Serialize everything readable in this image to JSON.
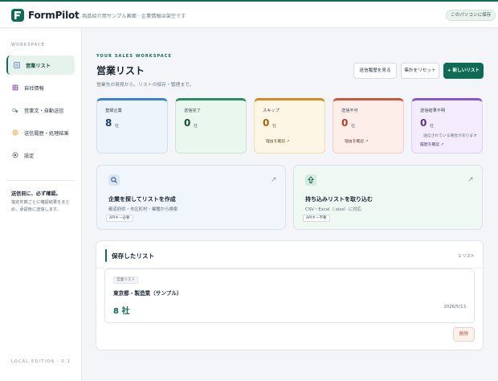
{
  "header": {
    "app_name": "FormPilot",
    "description": "商品紹介用サンプル画面 · 企業情報は架空です",
    "save_local_label": "このパソコンに保存"
  },
  "sidebar": {
    "workspace_label": "WORKSPACE",
    "items": [
      {
        "label": "営業リスト",
        "icon": "list-icon",
        "active": true
      },
      {
        "label": "自社情報",
        "icon": "building-icon",
        "active": false
      },
      {
        "label": "営業文・自動送信",
        "icon": "send-icon",
        "active": false
      },
      {
        "label": "送信履歴・処理結果",
        "icon": "history-icon",
        "active": false
      },
      {
        "label": "設定",
        "icon": "gear-icon",
        "active": false
      }
    ],
    "note_title": "送信前に、必ず確認。",
    "note_body": "指定件数ごとに確認結果をまとめ、承認後に送信します。",
    "edition": "LOCAL EDITION · 0.1"
  },
  "main": {
    "kicker": "YOUR SALES WORKSPACE",
    "title": "営業リスト",
    "subtitle": "営業先の発見から、リストの保存・管理まで。",
    "buttons": {
      "history": "送信履歴を見る",
      "reset": "集計をリセット",
      "new_list": "+ 新しいリスト"
    },
    "stats": [
      {
        "label": "登録企業",
        "value": "8",
        "unit": "社",
        "sub": "",
        "link": ""
      },
      {
        "label": "送信完了",
        "value": "0",
        "unit": "社",
        "sub": "",
        "link": ""
      },
      {
        "label": "スキップ",
        "value": "0",
        "unit": "社",
        "sub": "",
        "link": "理由を確認 ↗"
      },
      {
        "label": "送信不可",
        "value": "0",
        "unit": "社",
        "sub": "",
        "link": "理由を確認 ↗"
      },
      {
        "label": "送信結果不明",
        "value": "0",
        "unit": "社",
        "sub": "送信されている場合があります",
        "link": "履歴を確認 ↗"
      }
    ],
    "actions": [
      {
        "title": "企業を探してリストを作成",
        "desc": "都道府県・市区町村・業種から検索",
        "chip": "APIキー必要",
        "icon": "search-icon"
      },
      {
        "title": "持ち込みリストを取り込む",
        "desc": "CSV・Excel（.xlsx）に対応",
        "chip": "APIキー不要",
        "icon": "upload-icon"
      }
    ],
    "saved": {
      "title": "保存したリスト",
      "count": "1 リスト",
      "list": {
        "tag": "営業リスト",
        "name": "東京都・製造業（サンプル）",
        "num": "8 社",
        "date": "2026/5/13"
      },
      "delete_label": "削除"
    }
  },
  "colors": {
    "brand": "#0f6b55",
    "stat_blue": "#3f7fd0",
    "stat_green": "#2f8a63",
    "stat_amber": "#d48a1e",
    "stat_red": "#d0553b",
    "stat_purple": "#8358c7"
  }
}
